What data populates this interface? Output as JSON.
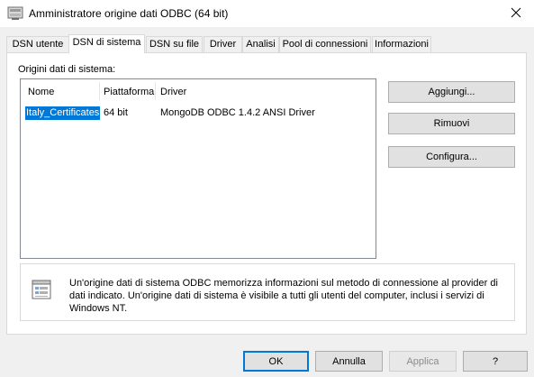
{
  "window": {
    "title": "Amministratore origine dati ODBC (64 bit)",
    "icon": "odbc-admin-icon"
  },
  "tabs": [
    {
      "label": "DSN utente",
      "active": false
    },
    {
      "label": "DSN di sistema",
      "active": true
    },
    {
      "label": "DSN su file",
      "active": false
    },
    {
      "label": "Driver",
      "active": false
    },
    {
      "label": "Analisi",
      "active": false
    },
    {
      "label": "Pool di connessioni",
      "active": false
    },
    {
      "label": "Informazioni",
      "active": false
    }
  ],
  "group_label": "Origini dati di sistema:",
  "list": {
    "columns": [
      "Nome",
      "Piattaforma",
      "Driver"
    ],
    "rows": [
      {
        "name": "Italy_Certificates",
        "platform": "64 bit",
        "driver": "MongoDB ODBC 1.4.2 ANSI Driver",
        "selected": true
      }
    ]
  },
  "side_buttons": {
    "add": "Aggiungi...",
    "remove": "Rimuovi",
    "configure": "Configura..."
  },
  "info": {
    "text": "Un'origine dati di sistema ODBC memorizza informazioni sul metodo di connessione al provider di dati indicato. Un'origine dati di sistema è visibile a tutti gli utenti del computer, inclusi i servizi di Windows NT."
  },
  "bottom_buttons": {
    "ok": "OK",
    "cancel": "Annulla",
    "apply": "Applica",
    "help": "?"
  },
  "colors": {
    "selection": "#0078d7",
    "default_button_border": "#0078d7"
  }
}
